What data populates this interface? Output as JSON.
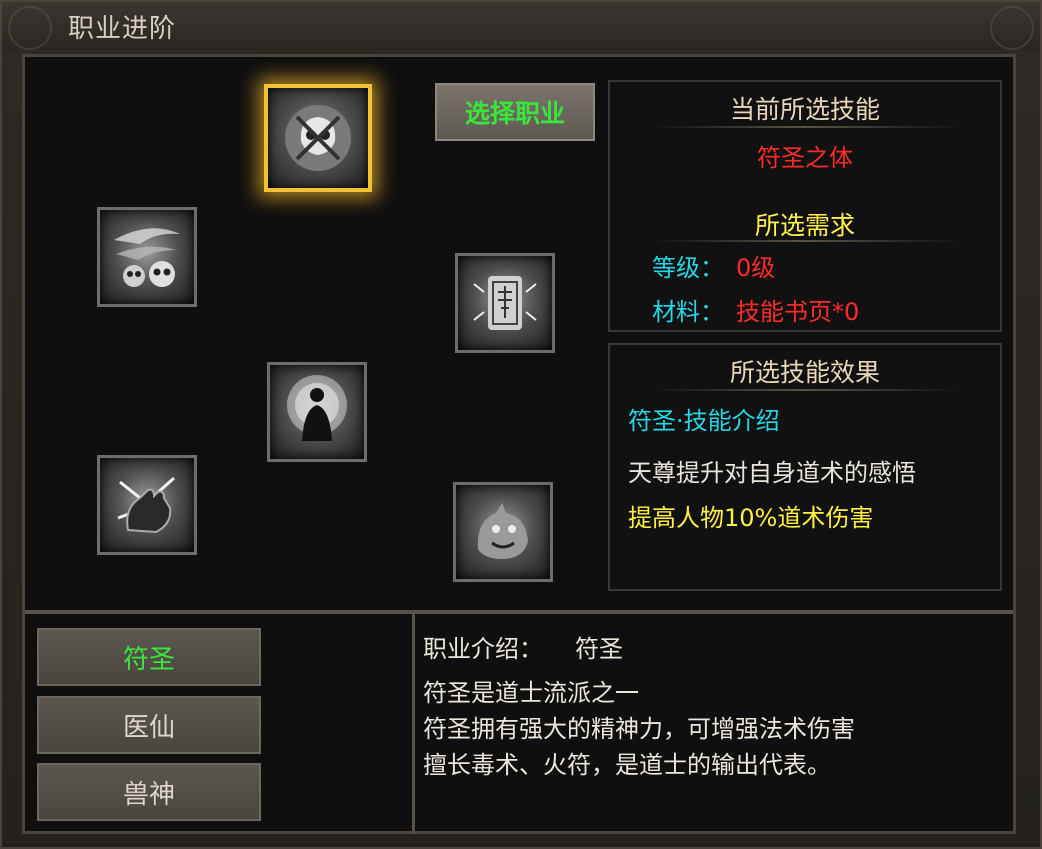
{
  "window": {
    "title": "职业进阶"
  },
  "skills": [
    {
      "name": "skulls-skill",
      "selected": false
    },
    {
      "name": "skull-charm-skill",
      "selected": true
    },
    {
      "name": "meditation-skill",
      "selected": false
    },
    {
      "name": "hand-skill",
      "selected": false
    },
    {
      "name": "talisman-skill",
      "selected": false
    },
    {
      "name": "beast-skill",
      "selected": false
    }
  ],
  "choose_button": {
    "label": "选择职业"
  },
  "current_skill": {
    "heading": "当前所选技能",
    "skill_name": "符圣之体"
  },
  "requirements": {
    "heading": "所选需求",
    "level_label": "等级：",
    "level_value": "0级",
    "material_label": "材料：",
    "material_value": "技能书页*0"
  },
  "effect": {
    "heading": "所选技能效果",
    "intro_title": "符圣·技能介绍",
    "line1": "天尊提升对自身道术的感悟",
    "line2": "提高人物10%道术伤害"
  },
  "classes": [
    {
      "label": "符圣",
      "active": true
    },
    {
      "label": "医仙",
      "active": false
    },
    {
      "label": "兽神",
      "active": false
    }
  ],
  "class_intro": {
    "label": "职业介绍：",
    "name": "符圣",
    "lines": [
      "符圣是道士流派之一",
      "符圣拥有强大的精神力，可增强法术伤害",
      "擅长毒术、火符，是道士的输出代表。"
    ]
  },
  "colors": {
    "accent_green": "#39e63c",
    "highlight_red": "#ff2b2b",
    "info_cyan": "#25d7e6",
    "effect_yellow": "#fff043",
    "selected_gold": "#f3c233"
  }
}
